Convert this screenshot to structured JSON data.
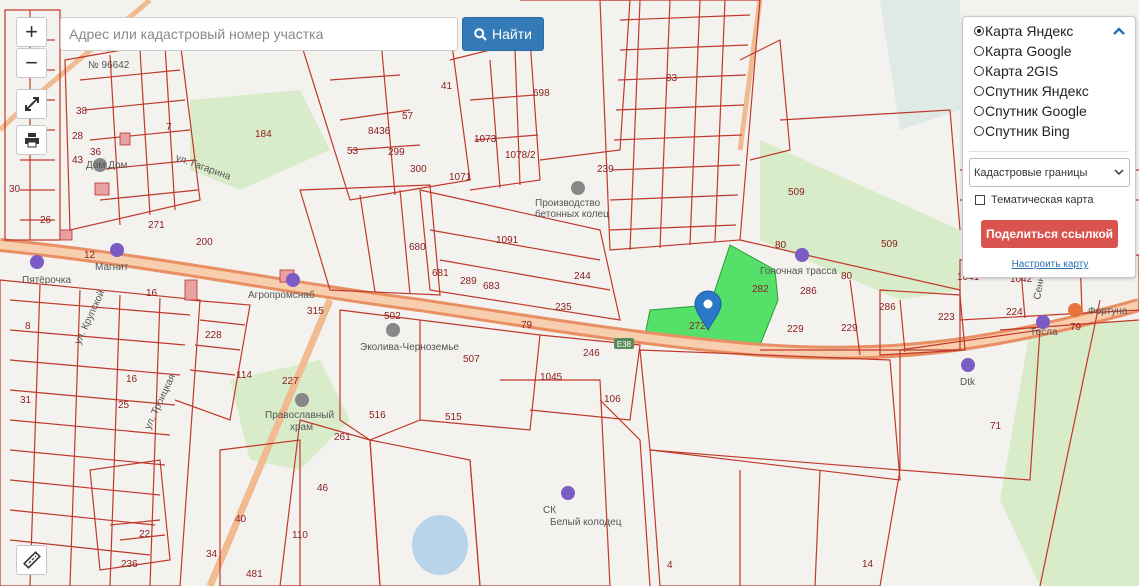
{
  "search": {
    "placeholder": "Адрес или кадастровый номер участка",
    "find_label": "Найти"
  },
  "map": {
    "parcel_labels": [
      "41",
      "698",
      "83",
      "184",
      "8436",
      "57",
      "53",
      "299",
      "300",
      "1073",
      "1078/2",
      "1071",
      "239",
      "1091",
      "509",
      "509",
      "680",
      "681",
      "289",
      "683",
      "244",
      "80",
      "282",
      "286",
      "80",
      "286",
      "1041",
      "1042",
      "315",
      "235",
      "79",
      "272",
      "229",
      "229",
      "223",
      "224",
      "79",
      "502",
      "507",
      "246",
      "1045",
      "228",
      "114",
      "227",
      "515",
      "106",
      "71",
      "516",
      "261",
      "46",
      "110",
      "22",
      "481",
      "236",
      "34",
      "14",
      "4",
      "200",
      "271",
      "16",
      "31",
      "25",
      "16",
      "40",
      "43",
      "28",
      "7",
      "26",
      "30",
      "36",
      "38",
      "12",
      "8"
    ],
    "street_labels": [
      "ул. Гагарина",
      "ул. Троицкая",
      "ул. Крупской",
      "Сенна"
    ],
    "road_badge": "E38",
    "side_text": "№ 96642",
    "pois": [
      {
        "name": "Производство бетонных колец"
      },
      {
        "name": "Гоночная трасса"
      },
      {
        "name": "Эколива-Черноземье"
      },
      {
        "name": "Православный храм"
      },
      {
        "name": "СК Белый колодец"
      },
      {
        "name": "Dtk"
      },
      {
        "name": "Фортуна"
      },
      {
        "name": "Магнит"
      },
      {
        "name": "Пятёрочка"
      },
      {
        "name": "Агропромснаб"
      },
      {
        "name": "Тесла"
      },
      {
        "name": "Дом Дом"
      }
    ]
  },
  "layers": {
    "options": [
      "Карта Яндекс",
      "Карта Google",
      "Карта 2GIS",
      "Спутник Яндекс",
      "Спутник Google",
      "Спутник Bing"
    ],
    "selected": "Карта Яндекс",
    "select_value": "Кадастровые границы",
    "thematic_label": "Тематическая карта",
    "share_label": "Поделиться ссылкой",
    "setup_label": "Настроить карту"
  },
  "colors": {
    "parcel": "#c0392b",
    "highlight": "#44e062",
    "road": "#f4b185",
    "forest": "#d6ebc8",
    "marker": "#2a78c8",
    "share": "#d9534f"
  }
}
